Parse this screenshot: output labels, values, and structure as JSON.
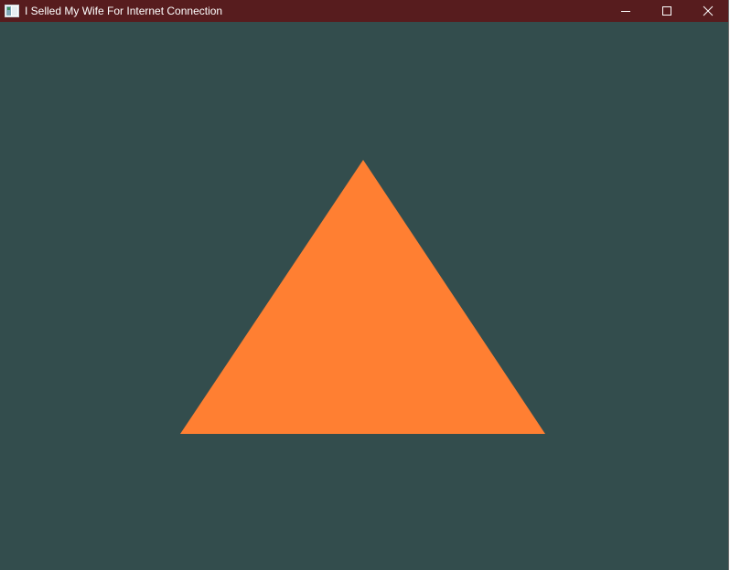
{
  "window": {
    "title": "I Selled My Wife For Internet Connection",
    "icon": "app-window-icon",
    "controls": [
      {
        "name": "minimize-icon"
      },
      {
        "name": "maximize-icon"
      },
      {
        "name": "close-icon"
      }
    ]
  },
  "colors": {
    "titlebar": "#571c1e",
    "background": "#334d4d",
    "triangle": "#ff7f32"
  }
}
